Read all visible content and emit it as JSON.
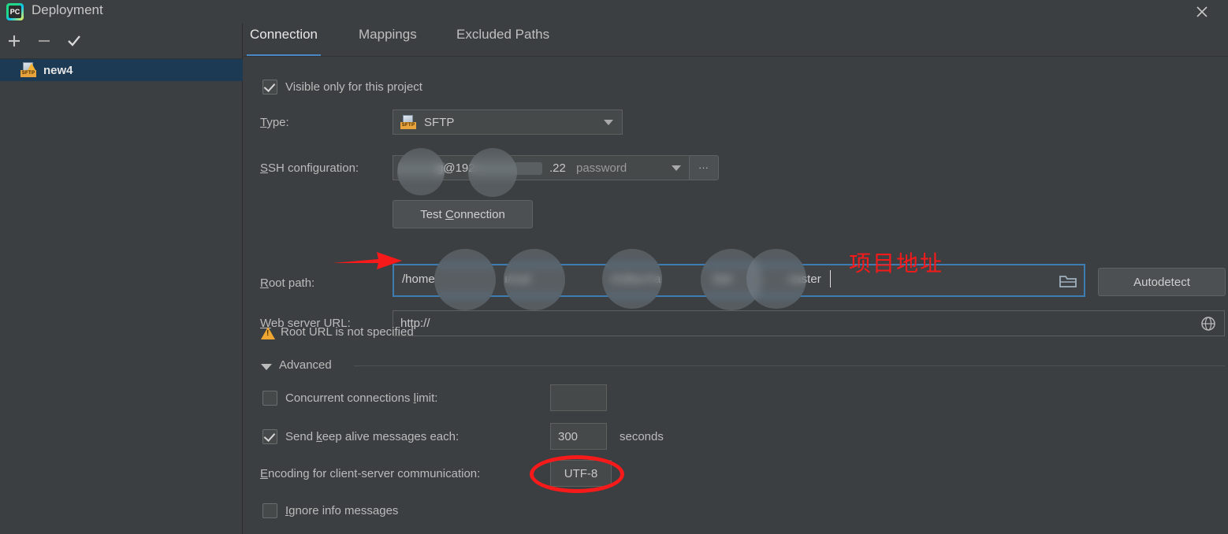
{
  "window": {
    "title": "Deployment",
    "app_icon": "pycharm-logo-icon",
    "close_icon": "close-icon"
  },
  "sidebar": {
    "toolbar": [
      {
        "name": "add-server-button",
        "icon": "plus-icon",
        "label": "+"
      },
      {
        "name": "remove-server-button",
        "icon": "minus-icon",
        "label": "−"
      },
      {
        "name": "set-default-server-button",
        "icon": "check-icon",
        "label": "✓"
      }
    ],
    "servers": [
      {
        "label": "new4",
        "icon": "sftp-server-icon",
        "badge": "SFTP",
        "selected": true
      }
    ]
  },
  "tabs": [
    {
      "label": "Connection",
      "active": true
    },
    {
      "label": "Mappings",
      "active": false
    },
    {
      "label": "Excluded Paths",
      "active": false
    }
  ],
  "form": {
    "visible_only_checkbox": {
      "label": "Visible only for this project",
      "checked": true
    },
    "type": {
      "label": "Type:",
      "mnemonic": "T",
      "value": "SFTP",
      "icon": "sftp-type-icon",
      "badge": "SFTP"
    },
    "ssh_configuration": {
      "label": "SSH configuration:",
      "mnemonic": "S",
      "value_visible": "g@192.",
      "value_visible_2": "22",
      "auth": "password",
      "browse_button": "...",
      "redacted": true
    },
    "test_connection_button": {
      "label": "Test Connection",
      "mnemonic": "C"
    },
    "root_path": {
      "label": "Root path:",
      "mnemonic": "R",
      "segments": [
        "/home",
        "ı/cod",
        "r/Ultra-Fa",
        "Det",
        "naster"
      ],
      "folder_icon": "folder-icon",
      "focused": true,
      "redacted": true
    },
    "autodetect_button": {
      "label": "Autodetect"
    },
    "web_server_url": {
      "label": "Web server URL:",
      "mnemonic": "W",
      "value": "http://",
      "globe_icon": "globe-icon"
    },
    "warning": {
      "text": "Root URL is not specified",
      "icon": "warning-icon"
    },
    "advanced": {
      "label": "Advanced",
      "expanded": true,
      "concurrent_connections": {
        "label": "Concurrent connections limit:",
        "mnemonic": "l",
        "checked": false,
        "value": ""
      },
      "keep_alive": {
        "label": "Send keep alive messages each:",
        "mnemonic": "k",
        "checked": true,
        "value": "300",
        "unit": "seconds"
      },
      "encoding": {
        "label": "Encoding for client-server communication:",
        "mnemonic": "E",
        "value": "UTF-8"
      },
      "ignore_info": {
        "label": "Ignore info messages",
        "mnemonic": "I",
        "checked": false
      }
    }
  },
  "annotations": {
    "arrow": {
      "name": "red-arrow-annotation",
      "points_to": "root-path-field"
    },
    "chinese_note": {
      "text": "项目地址"
    },
    "ellipse": {
      "name": "red-ellipse-annotation",
      "circles": "encoding-value"
    }
  },
  "colors": {
    "background": "#3c3f41",
    "selection": "#1d3a55",
    "tab_accent": "#4a88c7",
    "annotation_red": "#f61a1a",
    "warning_orange": "#f0a732",
    "field_bg": "#45494a"
  }
}
